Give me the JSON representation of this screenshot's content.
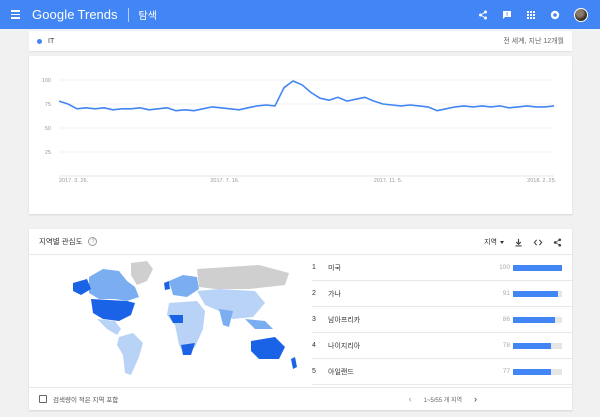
{
  "app": {
    "brand_google": "Google",
    "brand_trends": "Trends",
    "section": "탐색"
  },
  "search": {
    "term": "IT",
    "term_color": "#4285f4",
    "scope": "전 세계, 지난 12개월"
  },
  "chart_data": {
    "type": "line",
    "title": "",
    "xlabel": "",
    "ylabel": "",
    "ylim": [
      0,
      100
    ],
    "yticks": [
      "100",
      "75",
      "50",
      "25"
    ],
    "xticks": [
      "2017. 3. 26.",
      "2017. 7. 16.",
      "2017. 11. 5.",
      "2018. 2. 25."
    ],
    "grid": true,
    "series": [
      {
        "color": "#4285f4",
        "values": [
          78,
          75,
          70,
          71,
          70,
          71,
          69,
          70,
          70,
          71,
          69,
          70,
          71,
          68,
          69,
          68,
          70,
          72,
          71,
          70,
          69,
          71,
          73,
          74,
          73,
          92,
          99,
          95,
          87,
          81,
          79,
          82,
          78,
          80,
          82,
          78,
          75,
          74,
          73,
          74,
          73,
          72,
          68,
          70,
          72,
          73,
          72,
          73,
          72,
          73,
          71,
          72,
          73,
          72,
          72,
          73
        ]
      }
    ]
  },
  "region": {
    "title": "지역별 관심도",
    "help": "?",
    "select_label": "지역",
    "regions": [
      {
        "rank": "1",
        "name": "미국",
        "value": "100",
        "pct": 1.0
      },
      {
        "rank": "2",
        "name": "가나",
        "value": "91",
        "pct": 0.91
      },
      {
        "rank": "3",
        "name": "남아프리카",
        "value": "86",
        "pct": 0.86
      },
      {
        "rank": "4",
        "name": "나이지리아",
        "value": "78",
        "pct": 0.78
      },
      {
        "rank": "5",
        "name": "아일랜드",
        "value": "77",
        "pct": 0.77
      }
    ],
    "include_low_volume": "검색량이 적은 지역 포함",
    "pagination": "1~5/55 개 지역"
  },
  "colors": {
    "appbar": "#4285f4",
    "map_high": "#1a62e6",
    "map_mid": "#7aaef0",
    "map_low": "#b9d3f7",
    "map_none": "#cfcfcf"
  }
}
